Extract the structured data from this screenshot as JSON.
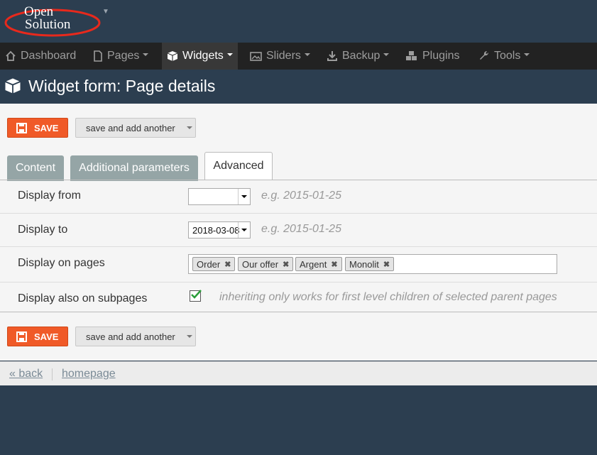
{
  "logo": {
    "line1": "Open",
    "line2": "Solution"
  },
  "nav": {
    "items": [
      {
        "label": "Dashboard",
        "icon": "home-icon"
      },
      {
        "label": "Pages",
        "icon": "file-icon"
      },
      {
        "label": "Widgets",
        "icon": "cube-icon"
      },
      {
        "label": "Sliders",
        "icon": "picture-icon"
      },
      {
        "label": "Backup",
        "icon": "download-icon"
      },
      {
        "label": "Plugins",
        "icon": "cubes-icon"
      },
      {
        "label": "Tools",
        "icon": "wrench-icon"
      }
    ]
  },
  "page": {
    "title": "Widget form: Page details"
  },
  "actions": {
    "save_label": "SAVE",
    "save_another_label": "save and add another"
  },
  "tabs": [
    {
      "label": "Content"
    },
    {
      "label": "Additional parameters"
    },
    {
      "label": "Advanced"
    }
  ],
  "form": {
    "display_from": {
      "label": "Display from",
      "value": "",
      "hint": "e.g. 2015-01-25"
    },
    "display_to": {
      "label": "Display to",
      "value": "2018-03-08",
      "hint": "e.g. 2015-01-25"
    },
    "display_on_pages": {
      "label": "Display on pages",
      "tags": [
        "Order",
        "Our offer",
        "Argent",
        "Monolit"
      ]
    },
    "display_subpages": {
      "label": "Display also on subpages",
      "checked": true,
      "hint": "inheriting only works for first level children of selected parent pages"
    }
  },
  "footer": {
    "back_label": "« back",
    "homepage_label": "homepage"
  },
  "colors": {
    "accent": "#f05a28",
    "header": "#2c3e50",
    "navbar": "#222222",
    "tab_inactive": "#95a5a6"
  }
}
